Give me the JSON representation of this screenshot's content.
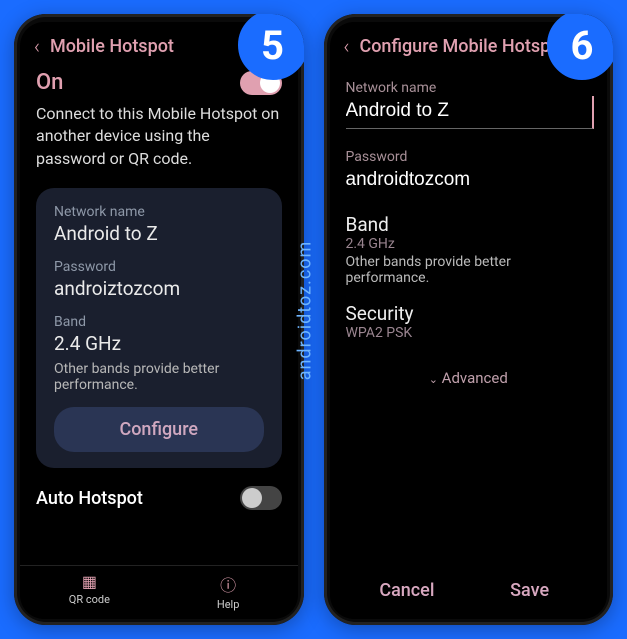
{
  "watermark": "androidtoz.com",
  "badges": {
    "left": "5",
    "right": "6"
  },
  "left": {
    "title": "Mobile Hotspot",
    "on": "On",
    "desc": "Connect to this Mobile Hotspot on another device using the password or QR code.",
    "network_label": "Network name",
    "network_value": "Android to Z",
    "password_label": "Password",
    "password_value": "androiztozcom",
    "band_label": "Band",
    "band_value": "2.4 GHz",
    "band_sub": "Other bands provide better performance.",
    "configure": "Configure",
    "auto": "Auto Hotspot",
    "nav_qr": "QR code",
    "nav_help": "Help"
  },
  "right": {
    "title": "Configure Mobile Hotspot",
    "network_label": "Network name",
    "network_value": "Android to Z",
    "password_label": "Password",
    "password_value": "androidtozcom",
    "band_title": "Band",
    "band_value": "2.4 GHz",
    "band_sub": "Other bands provide better performance.",
    "security_title": "Security",
    "security_value": "WPA2 PSK",
    "advanced": "Advanced",
    "cancel": "Cancel",
    "save": "Save"
  }
}
